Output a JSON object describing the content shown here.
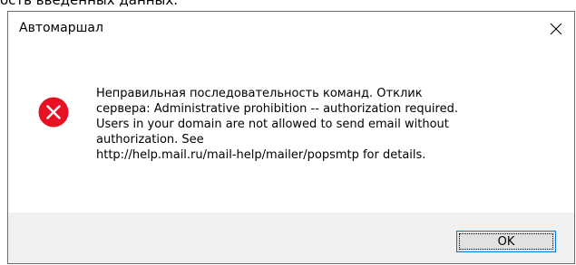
{
  "background": {
    "partial_text": "ость введённых данных."
  },
  "dialog": {
    "title": "Автомаршал",
    "message": "Неправильная последовательность команд. Отклик\nсервера: Administrative prohibition -- authorization required.\n Users in your domain are not allowed to send email without\nauthorization.  See\nhttp://help.mail.ru/mail-help/mailer/popsmtp for details.",
    "icon": "error-icon",
    "ok_label": "OK"
  },
  "colors": {
    "error_red": "#e81123",
    "button_face": "#e1e1e1",
    "button_focus_border": "#0078d7",
    "footer_bg": "#f0f0f0"
  }
}
